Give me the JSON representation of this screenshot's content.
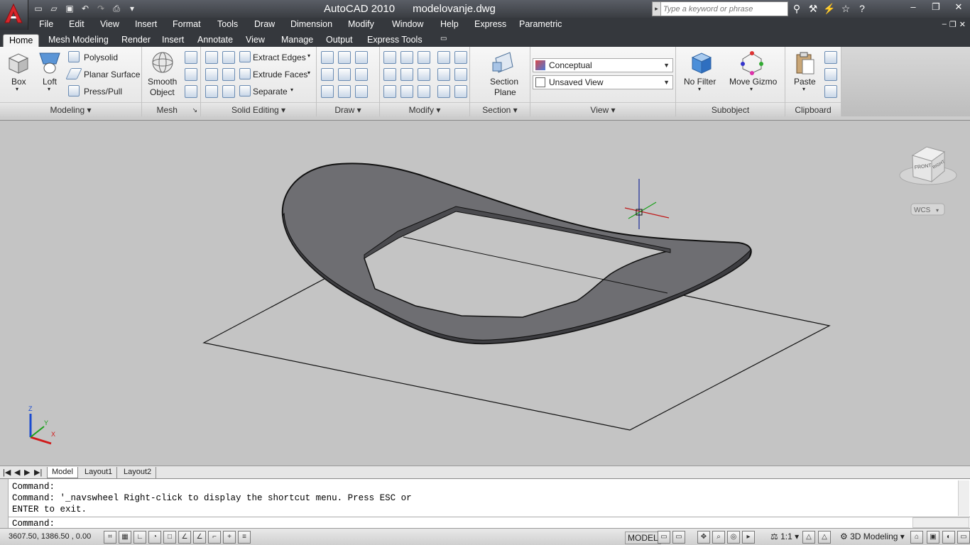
{
  "app": {
    "title": "AutoCAD 2010",
    "filename": "modelovanje.dwg",
    "search_placeholder": "Type a keyword or phrase"
  },
  "menu": [
    "File",
    "Edit",
    "View",
    "Insert",
    "Format",
    "Tools",
    "Draw",
    "Dimension",
    "Modify",
    "Window",
    "Help",
    "Express",
    "Parametric"
  ],
  "tabs": [
    "Home",
    "Mesh Modeling",
    "Render",
    "Insert",
    "Annotate",
    "View",
    "Manage",
    "Output",
    "Express Tools"
  ],
  "active_tab": "Home",
  "ribbon": {
    "modeling": {
      "title": "Modeling",
      "box": "Box",
      "loft": "Loft",
      "polysolid": "Polysolid",
      "planar_surface": "Planar Surface",
      "press_pull": "Press/Pull"
    },
    "mesh": {
      "title": "Mesh",
      "smooth_object_1": "Smooth",
      "smooth_object_2": "Object"
    },
    "solid_editing": {
      "title": "Solid Editing",
      "extract_edges": "Extract Edges",
      "extrude_faces": "Extrude Faces",
      "separate": "Separate"
    },
    "draw": {
      "title": "Draw"
    },
    "modify": {
      "title": "Modify"
    },
    "section": {
      "title": "Section",
      "section_plane_1": "Section",
      "section_plane_2": "Plane"
    },
    "view": {
      "title": "View",
      "visual_style": "Conceptual",
      "named_view": "Unsaved View"
    },
    "subobject": {
      "title": "Subobject",
      "no_filter": "No Filter",
      "move_gizmo": "Move Gizmo"
    },
    "clipboard": {
      "title": "Clipboard",
      "paste": "Paste"
    }
  },
  "viewcube": {
    "front": "FRONT",
    "right": "RIGHT",
    "wcs": "WCS"
  },
  "ucs": {
    "z": "Z",
    "y": "Y",
    "x": "X"
  },
  "layout_tabs": [
    "Model",
    "Layout1",
    "Layout2"
  ],
  "command": {
    "line1": "Command:",
    "line2": "Command: '_navswheel Right-click to display the shortcut menu. Press ESC or",
    "line3": "ENTER to exit.",
    "prompt": "Command:"
  },
  "status": {
    "coords": "3607.50, 1386.50 , 0.00",
    "model": "MODEL",
    "scale": "1:1",
    "workspace": "3D Modeling"
  },
  "colors": {
    "title_bg": "#3a3d42",
    "ribbon_bg": "#efefef",
    "canvas": "#c4c4c4",
    "shape": "#707074"
  }
}
